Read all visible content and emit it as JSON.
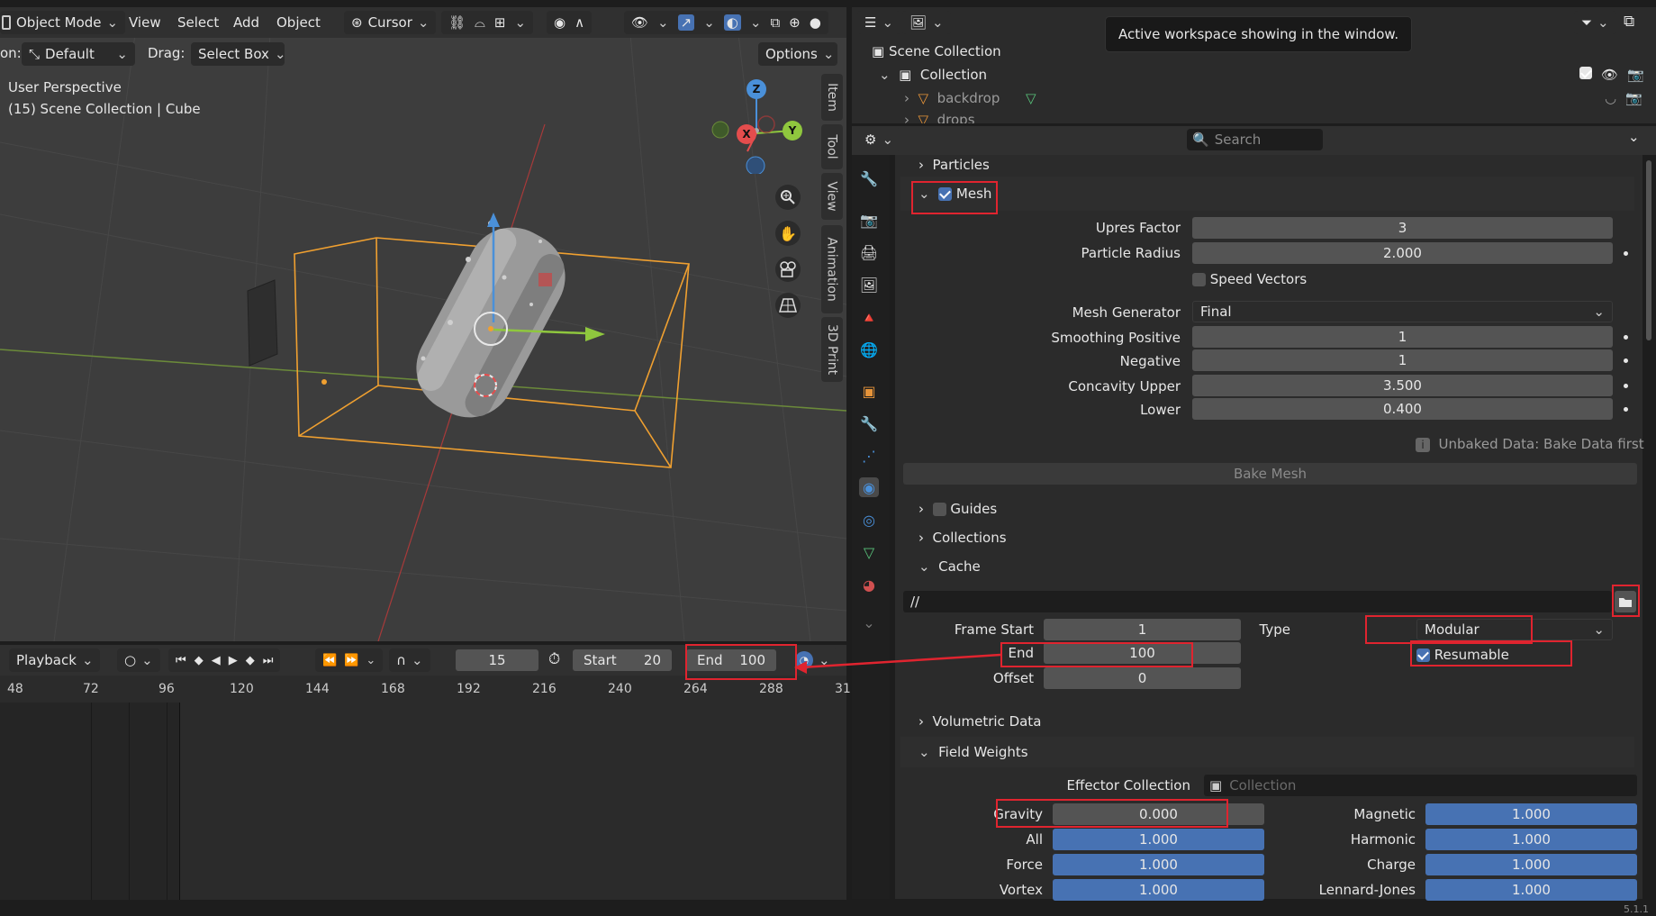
{
  "colors": {
    "accent": "#4772b3",
    "highlight": "#e0242f",
    "bounding_box": "#f0a030",
    "axis_x": "#e44d4d",
    "axis_y": "#8fc73e",
    "axis_z": "#4a90d9"
  },
  "viewport_header": {
    "mode": "Object Mode",
    "menus": [
      "View",
      "Select",
      "Add",
      "Object"
    ],
    "cursor": "Cursor",
    "orientation_label": "on:",
    "orientation": "Default",
    "drag_label": "Drag:",
    "drag": "Select Box",
    "options": "Options"
  },
  "viewport": {
    "perspective": "User Perspective",
    "info": "(15) Scene Collection | Cube",
    "side_tabs": [
      "Item",
      "Tool",
      "View",
      "Animation",
      "3D Print"
    ],
    "gizmo": {
      "z": "Z",
      "y": "Y",
      "x": "X"
    }
  },
  "timeline": {
    "playback": "Playback",
    "current_frame": "15",
    "start_label": "Start",
    "start": "20",
    "end_label": "End",
    "end": "100",
    "ticks": [
      "48",
      "72",
      "96",
      "120",
      "144",
      "168",
      "192",
      "216",
      "240",
      "264",
      "288",
      "31"
    ]
  },
  "outliner": {
    "tooltip": "Active workspace showing in the window.",
    "scene_collection": "Scene Collection",
    "collection": "Collection",
    "items": [
      "backdrop",
      "drops"
    ]
  },
  "properties": {
    "search_placeholder": "Search",
    "particles": "Particles",
    "mesh": {
      "label": "Mesh",
      "upres_label": "Upres Factor",
      "upres": "3",
      "radius_label": "Particle Radius",
      "radius": "2.000",
      "speed_vectors": "Speed Vectors",
      "generator_label": "Mesh Generator",
      "generator": "Final",
      "smooth_pos_label": "Smoothing Positive",
      "smooth_pos": "1",
      "negative_label": "Negative",
      "negative": "1",
      "conc_upper_label": "Concavity Upper",
      "conc_upper": "3.500",
      "lower_label": "Lower",
      "lower": "0.400",
      "unbaked": "Unbaked Data: Bake Data first",
      "bake": "Bake Mesh"
    },
    "guides": "Guides",
    "collections": "Collections",
    "cache": {
      "label": "Cache",
      "path": "//",
      "frame_start_label": "Frame Start",
      "frame_start": "1",
      "end_label": "End",
      "end": "100",
      "offset_label": "Offset",
      "offset": "0",
      "type_label": "Type",
      "type": "Modular",
      "resumable": "Resumable"
    },
    "volumetric": "Volumetric Data",
    "field_weights": {
      "label": "Field Weights",
      "effector_label": "Effector Collection",
      "effector_placeholder": "Collection",
      "left": [
        {
          "label": "Gravity",
          "value": "0.000"
        },
        {
          "label": "All",
          "value": "1.000"
        },
        {
          "label": "Force",
          "value": "1.000"
        },
        {
          "label": "Vortex",
          "value": "1.000"
        }
      ],
      "right": [
        {
          "label": "Magnetic",
          "value": "1.000"
        },
        {
          "label": "Harmonic",
          "value": "1.000"
        },
        {
          "label": "Charge",
          "value": "1.000"
        },
        {
          "label": "Lennard-Jones",
          "value": "1.000"
        }
      ]
    }
  },
  "status": {
    "version": "5.1.1"
  }
}
